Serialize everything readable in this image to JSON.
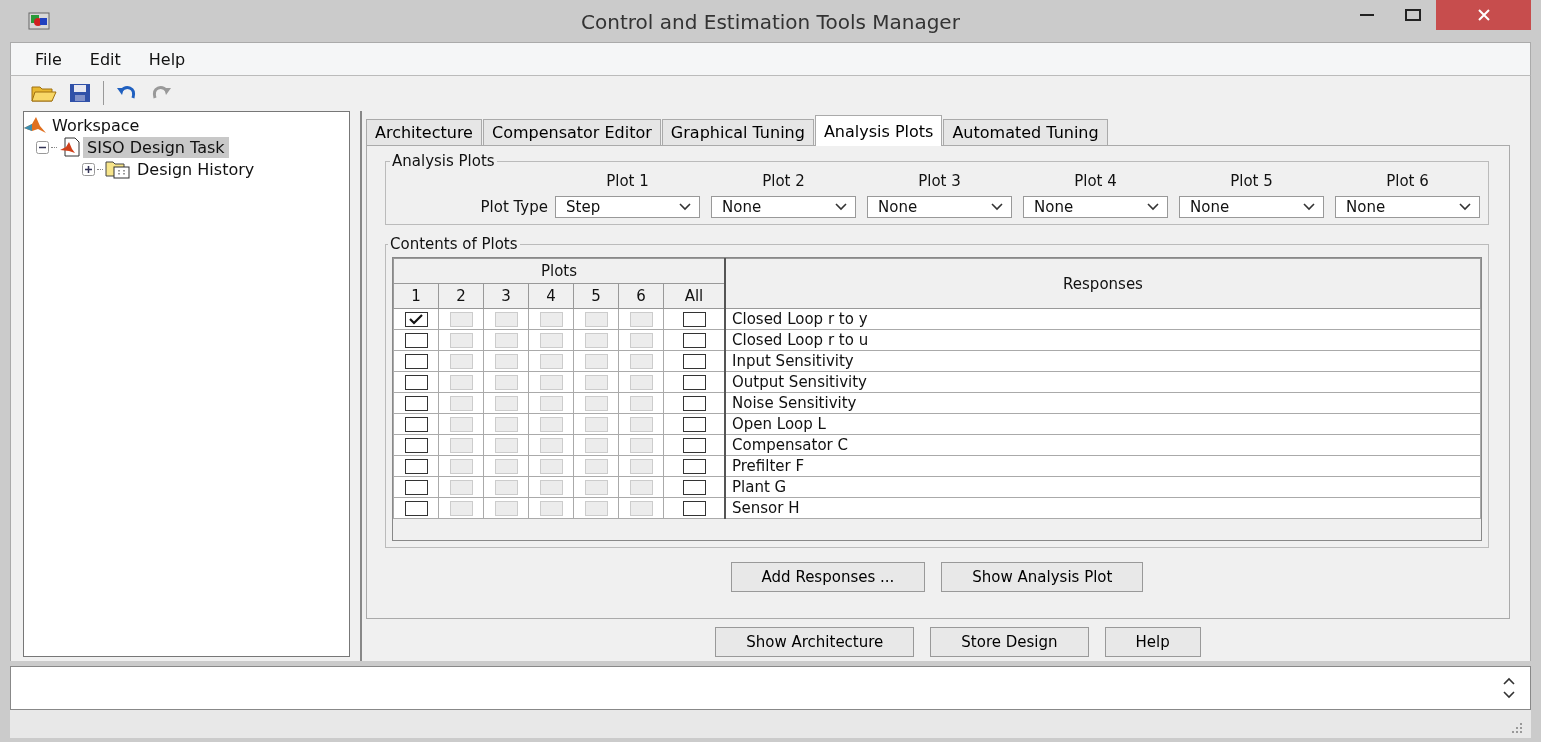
{
  "window": {
    "title": "Control and Estimation Tools Manager"
  },
  "menu": [
    "File",
    "Edit",
    "Help"
  ],
  "tree": [
    {
      "label": "Workspace",
      "kind": "workspace",
      "selected": false,
      "children": [
        {
          "label": "SISO Design Task",
          "kind": "task",
          "selected": true,
          "expanded": true,
          "children": [
            {
              "label": "Design History",
              "kind": "folder",
              "selected": false,
              "expanded": false
            }
          ]
        }
      ]
    }
  ],
  "tabs": [
    {
      "label": "Architecture",
      "selected": false
    },
    {
      "label": "Compensator Editor",
      "selected": false
    },
    {
      "label": "Graphical Tuning",
      "selected": false
    },
    {
      "label": "Analysis Plots",
      "selected": true
    },
    {
      "label": "Automated Tuning",
      "selected": false
    }
  ],
  "analysis_plots": {
    "title": "Analysis Plots",
    "row_label": "Plot Type",
    "plots": [
      {
        "label": "Plot 1",
        "type": "Step"
      },
      {
        "label": "Plot 2",
        "type": "None"
      },
      {
        "label": "Plot 3",
        "type": "None"
      },
      {
        "label": "Plot 4",
        "type": "None"
      },
      {
        "label": "Plot 5",
        "type": "None"
      },
      {
        "label": "Plot 6",
        "type": "None"
      }
    ]
  },
  "contents": {
    "title": "Contents of Plots",
    "group_header": "Plots",
    "columns": [
      "1",
      "2",
      "3",
      "4",
      "5",
      "6",
      "All"
    ],
    "responses_header": "Responses",
    "rows": [
      {
        "response": "Closed Loop r to y",
        "checks": [
          {
            "checked": true,
            "disabled": false
          },
          {
            "checked": false,
            "disabled": true
          },
          {
            "checked": false,
            "disabled": true
          },
          {
            "checked": false,
            "disabled": true
          },
          {
            "checked": false,
            "disabled": true
          },
          {
            "checked": false,
            "disabled": true
          },
          {
            "checked": false,
            "disabled": false
          }
        ]
      },
      {
        "response": "Closed Loop r to u",
        "checks": [
          {
            "checked": false,
            "disabled": false
          },
          {
            "checked": false,
            "disabled": true
          },
          {
            "checked": false,
            "disabled": true
          },
          {
            "checked": false,
            "disabled": true
          },
          {
            "checked": false,
            "disabled": true
          },
          {
            "checked": false,
            "disabled": true
          },
          {
            "checked": false,
            "disabled": false
          }
        ]
      },
      {
        "response": "Input Sensitivity",
        "checks": [
          {
            "checked": false,
            "disabled": false
          },
          {
            "checked": false,
            "disabled": true
          },
          {
            "checked": false,
            "disabled": true
          },
          {
            "checked": false,
            "disabled": true
          },
          {
            "checked": false,
            "disabled": true
          },
          {
            "checked": false,
            "disabled": true
          },
          {
            "checked": false,
            "disabled": false
          }
        ]
      },
      {
        "response": "Output Sensitivity",
        "checks": [
          {
            "checked": false,
            "disabled": false
          },
          {
            "checked": false,
            "disabled": true
          },
          {
            "checked": false,
            "disabled": true
          },
          {
            "checked": false,
            "disabled": true
          },
          {
            "checked": false,
            "disabled": true
          },
          {
            "checked": false,
            "disabled": true
          },
          {
            "checked": false,
            "disabled": false
          }
        ]
      },
      {
        "response": "Noise Sensitivity",
        "checks": [
          {
            "checked": false,
            "disabled": false
          },
          {
            "checked": false,
            "disabled": true
          },
          {
            "checked": false,
            "disabled": true
          },
          {
            "checked": false,
            "disabled": true
          },
          {
            "checked": false,
            "disabled": true
          },
          {
            "checked": false,
            "disabled": true
          },
          {
            "checked": false,
            "disabled": false
          }
        ]
      },
      {
        "response": "Open Loop L",
        "checks": [
          {
            "checked": false,
            "disabled": false
          },
          {
            "checked": false,
            "disabled": true
          },
          {
            "checked": false,
            "disabled": true
          },
          {
            "checked": false,
            "disabled": true
          },
          {
            "checked": false,
            "disabled": true
          },
          {
            "checked": false,
            "disabled": true
          },
          {
            "checked": false,
            "disabled": false
          }
        ]
      },
      {
        "response": "Compensator C",
        "checks": [
          {
            "checked": false,
            "disabled": false
          },
          {
            "checked": false,
            "disabled": true
          },
          {
            "checked": false,
            "disabled": true
          },
          {
            "checked": false,
            "disabled": true
          },
          {
            "checked": false,
            "disabled": true
          },
          {
            "checked": false,
            "disabled": true
          },
          {
            "checked": false,
            "disabled": false
          }
        ]
      },
      {
        "response": "Prefilter F",
        "checks": [
          {
            "checked": false,
            "disabled": false
          },
          {
            "checked": false,
            "disabled": true
          },
          {
            "checked": false,
            "disabled": true
          },
          {
            "checked": false,
            "disabled": true
          },
          {
            "checked": false,
            "disabled": true
          },
          {
            "checked": false,
            "disabled": true
          },
          {
            "checked": false,
            "disabled": false
          }
        ]
      },
      {
        "response": "Plant G",
        "checks": [
          {
            "checked": false,
            "disabled": false
          },
          {
            "checked": false,
            "disabled": true
          },
          {
            "checked": false,
            "disabled": true
          },
          {
            "checked": false,
            "disabled": true
          },
          {
            "checked": false,
            "disabled": true
          },
          {
            "checked": false,
            "disabled": true
          },
          {
            "checked": false,
            "disabled": false
          }
        ]
      },
      {
        "response": "Sensor H",
        "checks": [
          {
            "checked": false,
            "disabled": false
          },
          {
            "checked": false,
            "disabled": true
          },
          {
            "checked": false,
            "disabled": true
          },
          {
            "checked": false,
            "disabled": true
          },
          {
            "checked": false,
            "disabled": true
          },
          {
            "checked": false,
            "disabled": true
          },
          {
            "checked": false,
            "disabled": false
          }
        ]
      }
    ]
  },
  "panel_buttons": [
    "Add Responses ...",
    "Show Analysis Plot"
  ],
  "footer_buttons": [
    "Show Architecture",
    "Store Design",
    "Help"
  ]
}
